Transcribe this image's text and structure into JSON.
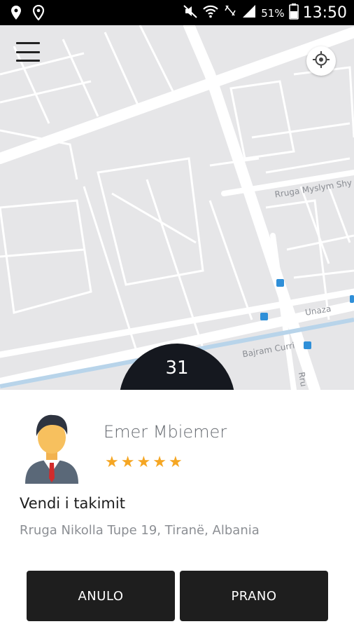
{
  "status_bar": {
    "battery_percent": "51%",
    "time": "13:50",
    "icons": [
      "location-pin-icon",
      "map-marker-icon",
      "mute-icon",
      "wifi-icon",
      "signal-icon",
      "battery-icon"
    ]
  },
  "map": {
    "streets": {
      "myslym": "Rruga Myslym Shy",
      "unaza": "Unaza",
      "bajram": "Bajram Curri",
      "rru": "Rru"
    },
    "colors": {
      "background": "#e6e6e8",
      "roads": "#ffffff",
      "river": "#b8d4ea",
      "transit": "#2f8fd8"
    }
  },
  "countdown": {
    "value": "31"
  },
  "driver": {
    "name": "Emer Mbiemer",
    "rating": 5
  },
  "meeting": {
    "title": "Vendi i takimit",
    "address": "Rruga Nikolla Tupe 19, Tiranë, Albania"
  },
  "actions": {
    "cancel_label": "ANULO",
    "accept_label": "PRANO"
  },
  "colors": {
    "star": "#f5a623",
    "button_bg": "#1e1e1e",
    "countdown_bg": "#15181f"
  }
}
